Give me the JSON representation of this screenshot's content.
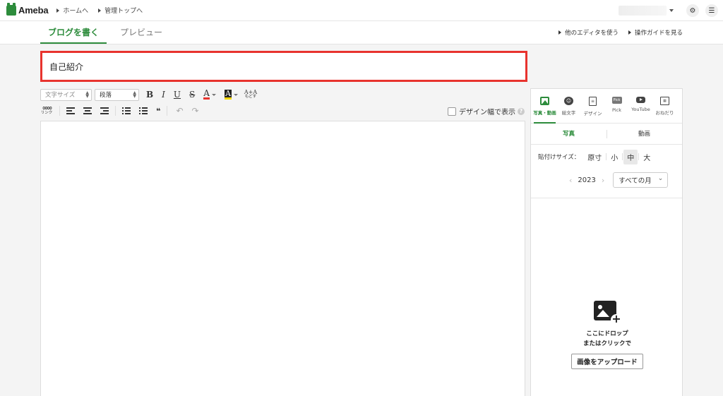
{
  "header": {
    "logo": "Ameba",
    "breadcrumbs": [
      "ホームへ",
      "管理トップへ"
    ]
  },
  "tabs": {
    "write": "ブログを書く",
    "preview": "プレビュー"
  },
  "links": {
    "other_editor": "他のエディタを使う",
    "guide": "操作ガイドを見る"
  },
  "title_input": {
    "value": "自己紹介"
  },
  "toolbar": {
    "font_size": "文字サイズ",
    "paragraph": "段落",
    "bold": "B",
    "italic": "I",
    "underline": "U",
    "strike": "S",
    "text_color": "A",
    "highlight": "A",
    "reset_top": "A+A",
    "reset_bottom": "もどす",
    "link_label": "リンク",
    "design_width": "デザイン幅で表示"
  },
  "panel": {
    "tabs": [
      {
        "label": "写真・動画",
        "icon": "image-icon"
      },
      {
        "label": "絵文字",
        "icon": "emoji-icon"
      },
      {
        "label": "デザイン",
        "icon": "design-icon"
      },
      {
        "label": "Pick",
        "icon": "pick-icon"
      },
      {
        "label": "YouTube",
        "icon": "youtube-icon"
      },
      {
        "label": "おねだり",
        "icon": "gift-icon"
      }
    ],
    "pick_badge": "Pick",
    "subtabs": [
      "写真",
      "動画"
    ],
    "paste_label": "貼付けサイズ：",
    "sizes": [
      "原寸",
      "小",
      "中",
      "大"
    ],
    "active_size": "中",
    "year": "2023",
    "month_select": "すべての月",
    "drop_line1": "ここにドロップ",
    "drop_line2": "またはクリックで",
    "upload_button": "画像をアップロード"
  },
  "colors": {
    "accent": "#2d8c3c",
    "title_border": "#e8332e",
    "text_color_bar": "#e8332e",
    "highlight_bar": "#f2d500"
  }
}
